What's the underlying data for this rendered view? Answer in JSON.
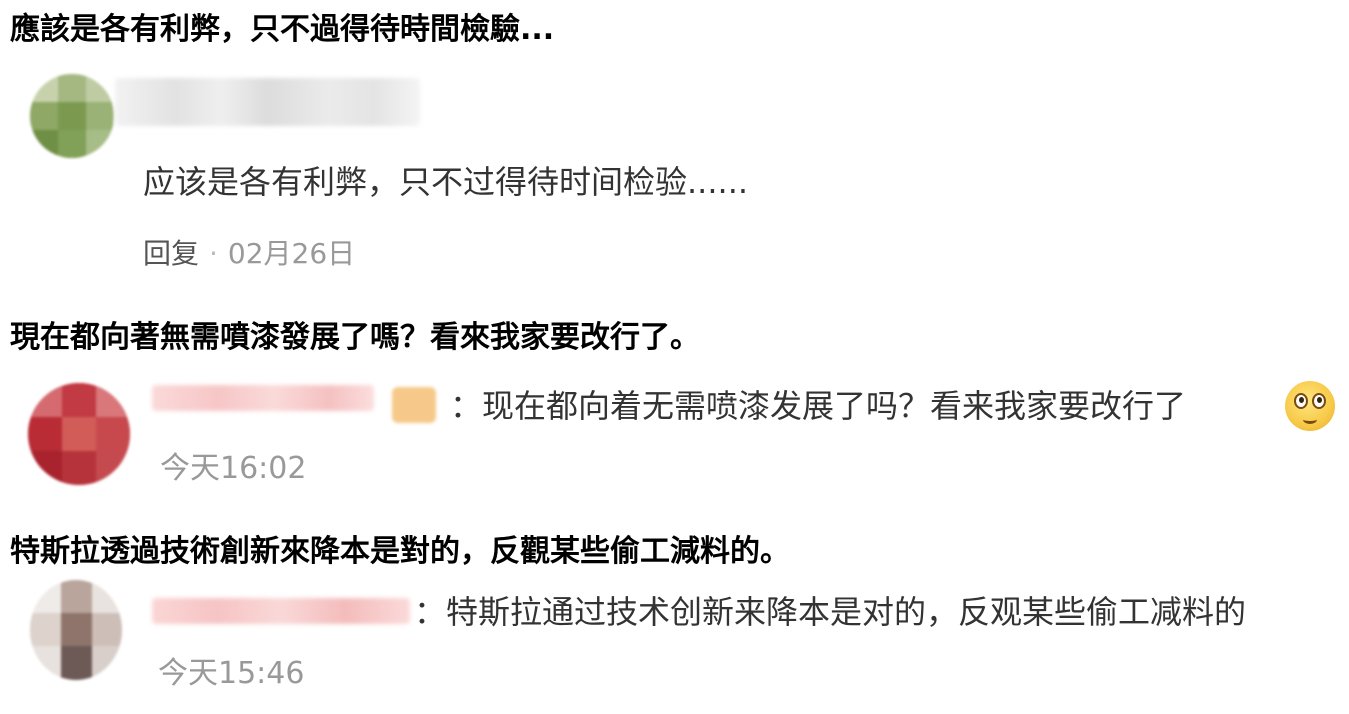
{
  "captions": [
    "應該是各有利弊，只不過得待時間檢驗...",
    "現在都向著無需噴漆發展了嗎？看來我家要改行了。",
    "特斯拉透過技術創新來降本是對的，反觀某些偷工減料的。"
  ],
  "comments": [
    {
      "text": "应该是各有利弊，只不过得待时间检验......",
      "reply_label": "回复",
      "separator": "·",
      "date": "02月26日"
    },
    {
      "prefix": "：",
      "text": "现在都向着无需喷漆发展了吗？看来我家要改行了",
      "emoji": "rolling-eyes-emoji",
      "time": "今天16:02"
    },
    {
      "prefix": "：",
      "text": "特斯拉通过技术创新来降本是对的，反观某些偷工减料的",
      "time": "今天15:46"
    }
  ],
  "colors": {
    "caption": "#000000",
    "comment_text": "#333333",
    "meta": "#999999"
  }
}
